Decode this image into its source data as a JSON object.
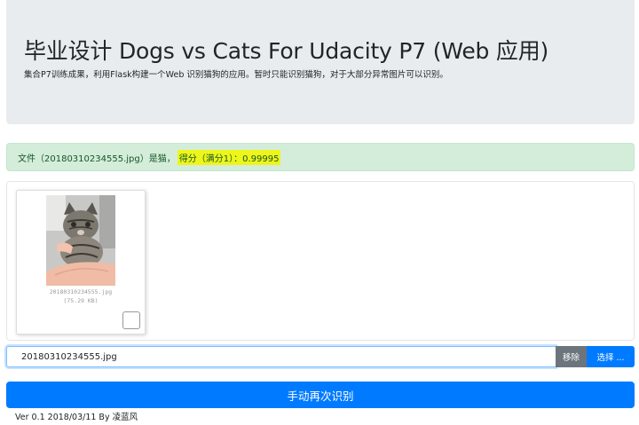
{
  "header": {
    "title": "毕业设计 Dogs vs Cats For Udacity P7 (Web 应用)",
    "lead": "集合P7训练成果，利用Flask构建一个Web 识别猫狗的应用。暂时只能识别猫狗，对于大部分异常图片可以识别。"
  },
  "result": {
    "prefix": "文件（20180310234555.jpg）是猫，",
    "score": "得分（满分1）：0.99995",
    "highlight_color": "#eef51a"
  },
  "preview": {
    "file_name": "20180310234555.jpg",
    "file_size": "(75.29 KB)",
    "image_icon": "cat-photo"
  },
  "file_input": {
    "caption": "20180310234555.jpg",
    "remove_label": "移除",
    "browse_label": "选择 ..."
  },
  "actions": {
    "recognize_label": "手动再次识别"
  },
  "footer": {
    "text": "Ver 0.1 2018/03/11 By 凌蓝风"
  },
  "colors": {
    "primary": "#007bff",
    "secondary": "#6c757d",
    "success_bg": "#d4edda",
    "success_text": "#155724",
    "jumbotron_bg": "#e9ecef"
  }
}
